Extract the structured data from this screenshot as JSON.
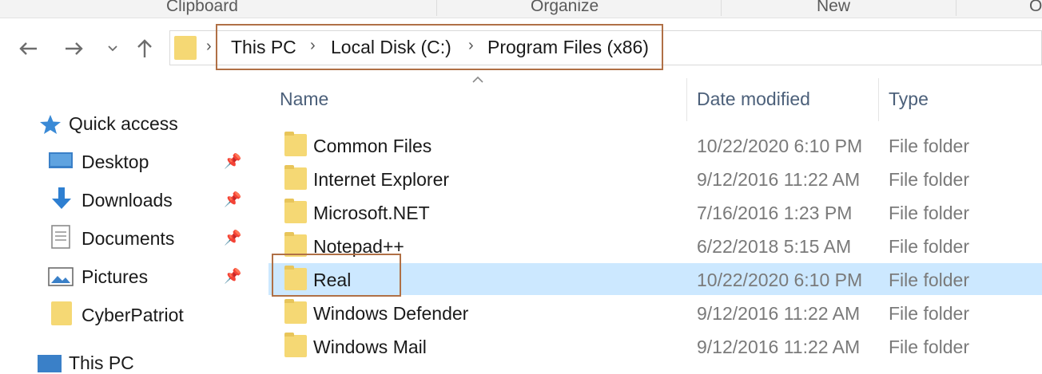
{
  "ribbon": {
    "groups": [
      "Clipboard",
      "Organize",
      "New",
      "O"
    ]
  },
  "address": {
    "crumbs": [
      "This PC",
      "Local Disk (C:)",
      "Program Files (x86)"
    ],
    "separator": "›"
  },
  "nav": {
    "quick_access": "Quick access",
    "items": [
      {
        "label": "Desktop",
        "icon": "desktop-icon",
        "pinned": true
      },
      {
        "label": "Downloads",
        "icon": "downloads-icon",
        "pinned": true
      },
      {
        "label": "Documents",
        "icon": "documents-icon",
        "pinned": true
      },
      {
        "label": "Pictures",
        "icon": "pictures-icon",
        "pinned": true
      },
      {
        "label": "CyberPatriot",
        "icon": "folder-icon",
        "pinned": false
      }
    ],
    "this_pc": "This PC"
  },
  "columns": {
    "name": "Name",
    "date": "Date modified",
    "type": "Type"
  },
  "files": [
    {
      "name": "Common Files",
      "date": "10/22/2020 6:10 PM",
      "type": "File folder",
      "selected": false
    },
    {
      "name": "Internet Explorer",
      "date": "9/12/2016 11:22 AM",
      "type": "File folder",
      "selected": false
    },
    {
      "name": "Microsoft.NET",
      "date": "7/16/2016 1:23 PM",
      "type": "File folder",
      "selected": false
    },
    {
      "name": "Notepad++",
      "date": "6/22/2018 5:15 AM",
      "type": "File folder",
      "selected": false
    },
    {
      "name": "Real",
      "date": "10/22/2020 6:10 PM",
      "type": "File folder",
      "selected": true
    },
    {
      "name": "Windows Defender",
      "date": "9/12/2016 11:22 AM",
      "type": "File folder",
      "selected": false
    },
    {
      "name": "Windows Mail",
      "date": "9/12/2016 11:22 AM",
      "type": "File folder",
      "selected": false
    }
  ],
  "colors": {
    "selected_row": "#cce8ff",
    "highlight_box": "#b07046",
    "folder": "#f5d874"
  }
}
